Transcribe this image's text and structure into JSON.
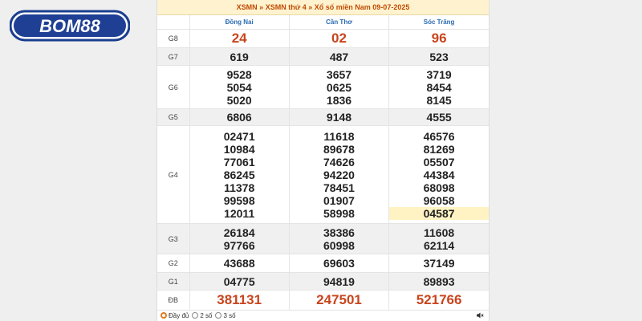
{
  "logo": {
    "text": "BOM88"
  },
  "header": {
    "crumb1": "XSMN",
    "sep1": "»",
    "crumb2": "XSMN thứ 4",
    "sep2": "»",
    "crumb3": "Xổ số miền Nam 09-07-2025"
  },
  "provinces": [
    "Đồng Nai",
    "Cần Thơ",
    "Sóc Trăng"
  ],
  "rows": {
    "g8": {
      "label": "G8",
      "values": [
        "24",
        "02",
        "96"
      ]
    },
    "g7": {
      "label": "G7",
      "values": [
        "619",
        "487",
        "523"
      ]
    },
    "g6": {
      "label": "G6",
      "values": [
        [
          "9528",
          "5054",
          "5020"
        ],
        [
          "3657",
          "0625",
          "1836"
        ],
        [
          "3719",
          "8454",
          "8145"
        ]
      ]
    },
    "g5": {
      "label": "G5",
      "values": [
        "6806",
        "9148",
        "4555"
      ]
    },
    "g4": {
      "label": "G4",
      "values": [
        [
          "02471",
          "10984",
          "77061",
          "86245",
          "11378",
          "99598",
          "12011"
        ],
        [
          "11618",
          "89678",
          "74626",
          "94220",
          "78451",
          "01907",
          "58998"
        ],
        [
          "46576",
          "81269",
          "05507",
          "44384",
          "68098",
          "96058",
          "04587"
        ]
      ]
    },
    "g3": {
      "label": "G3",
      "values": [
        [
          "26184",
          "97766"
        ],
        [
          "38386",
          "60998"
        ],
        [
          "11608",
          "62114"
        ]
      ]
    },
    "g2": {
      "label": "G2",
      "values": [
        "43688",
        "69603",
        "37149"
      ]
    },
    "g1": {
      "label": "G1",
      "values": [
        "04775",
        "94819",
        "89893"
      ]
    },
    "db": {
      "label": "ĐB",
      "values": [
        "381131",
        "247501",
        "521766"
      ]
    }
  },
  "footer": {
    "opt_full": "Đầy đủ",
    "opt_2": "2 số",
    "opt_3": "3 số",
    "selected": "Đầy đủ"
  },
  "colors": {
    "accent": "#c8451e",
    "province": "#2a6bb3",
    "highlight": "#fff3c4",
    "header_bg": "#fff3cf"
  }
}
